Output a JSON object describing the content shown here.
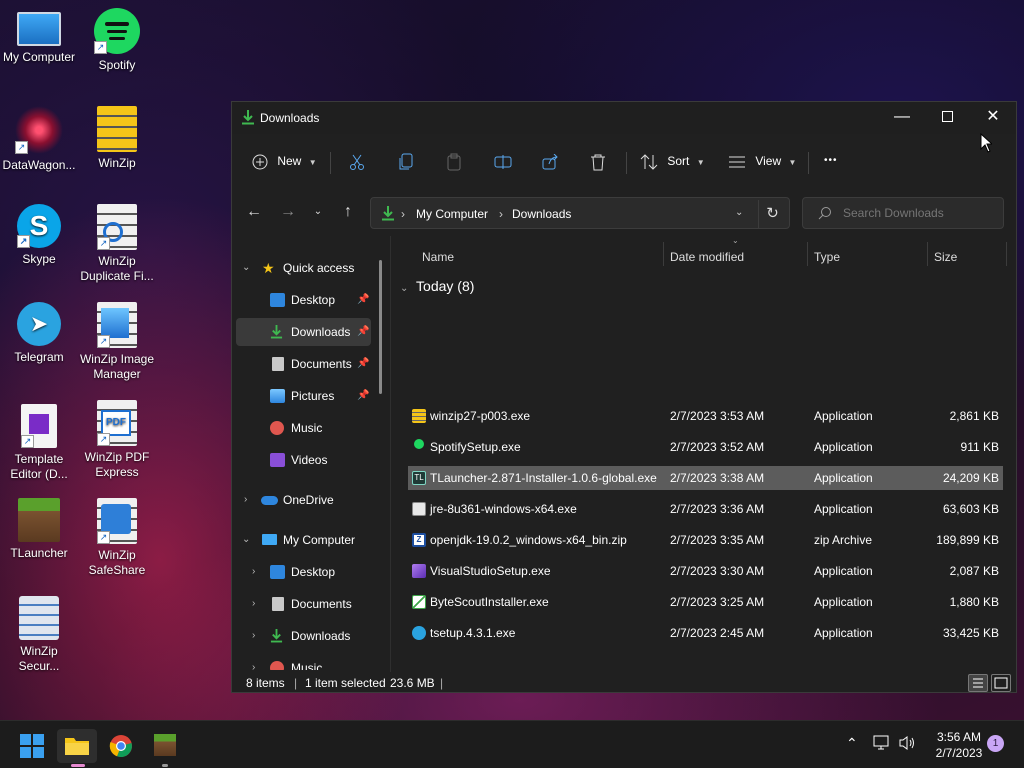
{
  "desktop": {
    "icons": [
      {
        "label": "My Computer"
      },
      {
        "label": "Spotify"
      },
      {
        "label": "DataWagon..."
      },
      {
        "label": "WinZip"
      },
      {
        "label": "Skype"
      },
      {
        "label": "WinZip Duplicate Fi..."
      },
      {
        "label": "Telegram"
      },
      {
        "label": "WinZip Image Manager"
      },
      {
        "label": "Template Editor (D..."
      },
      {
        "label": "WinZip PDF Express"
      },
      {
        "label": "TLauncher"
      },
      {
        "label": "WinZip SafeShare"
      },
      {
        "label": "WinZip Secur..."
      }
    ]
  },
  "window": {
    "title": "Downloads",
    "toolbar": {
      "new_label": "New",
      "sort_label": "Sort",
      "view_label": "View",
      "more_label": "•••"
    },
    "address": {
      "part1": "My Computer",
      "part2": "Downloads"
    },
    "search": {
      "placeholder": "Search Downloads"
    },
    "nav": {
      "quick_access": "Quick access",
      "items": [
        "Desktop",
        "Downloads",
        "Documents",
        "Pictures",
        "Music",
        "Videos"
      ],
      "onedrive": "OneDrive",
      "my_computer": "My Computer",
      "pc_items": [
        "Desktop",
        "Documents",
        "Downloads",
        "Music"
      ]
    },
    "columns": {
      "name": "Name",
      "date": "Date modified",
      "type": "Type",
      "size": "Size"
    },
    "group_label": "Today (8)",
    "files": [
      {
        "name": "winzip27-p003.exe",
        "date": "2/7/2023 3:53 AM",
        "type": "Application",
        "size": "2,861 KB"
      },
      {
        "name": "SpotifySetup.exe",
        "date": "2/7/2023 3:52 AM",
        "type": "Application",
        "size": "911 KB"
      },
      {
        "name": "TLauncher-2.871-Installer-1.0.6-global.exe",
        "date": "2/7/2023 3:38 AM",
        "type": "Application",
        "size": "24,209 KB"
      },
      {
        "name": "jre-8u361-windows-x64.exe",
        "date": "2/7/2023 3:36 AM",
        "type": "Application",
        "size": "63,603 KB"
      },
      {
        "name": "openjdk-19.0.2_windows-x64_bin.zip",
        "date": "2/7/2023 3:35 AM",
        "type": "zip Archive",
        "size": "189,899 KB"
      },
      {
        "name": "VisualStudioSetup.exe",
        "date": "2/7/2023 3:30 AM",
        "type": "Application",
        "size": "2,087 KB"
      },
      {
        "name": "ByteScoutInstaller.exe",
        "date": "2/7/2023 3:25 AM",
        "type": "Application",
        "size": "1,880 KB"
      },
      {
        "name": "tsetup.4.3.1.exe",
        "date": "2/7/2023 2:45 AM",
        "type": "Application",
        "size": "33,425 KB"
      }
    ],
    "status": {
      "items": "8 items",
      "selected": "1 item selected",
      "size": "23.6 MB",
      "bar": "|"
    }
  },
  "taskbar": {
    "time": "3:56 AM",
    "date": "2/7/2023",
    "notification_count": "1"
  },
  "colors": {
    "window_bg": "#202020",
    "selected_row": "#5c5c5c",
    "accent_green": "#3fb950",
    "folder_blue": "#2e86de"
  }
}
